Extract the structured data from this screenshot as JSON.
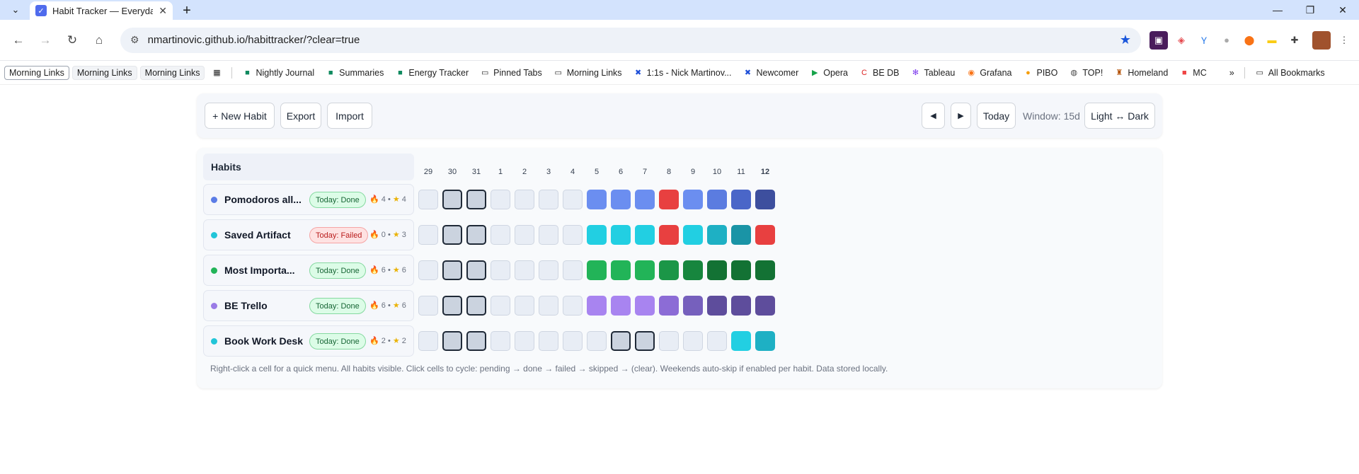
{
  "browser": {
    "tab_title": "Habit Tracker — Everyday-style",
    "url": "nmartinovic.github.io/habittracker/?clear=true",
    "bookmarks": [
      "Morning Links",
      "Morning Links",
      "Morning Links",
      "Nightly Journal",
      "Summaries",
      "Energy Tracker",
      "Pinned Tabs",
      "Morning Links",
      "1:1s - Nick Martinov...",
      "Newcomer",
      "Opera",
      "BE DB",
      "Tableau",
      "Grafana",
      "PIBO",
      "TOP!",
      "Homeland",
      "MC"
    ],
    "all_bookmarks": "All Bookmarks"
  },
  "toolbar": {
    "new_habit": "+ New Habit",
    "export": "Export",
    "import": "Import",
    "prev": "◀",
    "next": "▶",
    "today": "Today",
    "window": "Window: 15d",
    "theme": "Light ↔ Dark"
  },
  "grid": {
    "header": "Habits",
    "days": [
      "29",
      "30",
      "31",
      "1",
      "2",
      "3",
      "4",
      "5",
      "6",
      "7",
      "8",
      "9",
      "10",
      "11",
      "12"
    ],
    "today_index": 14
  },
  "habits": [
    {
      "name": "Pomodoros all...",
      "status": "Today: Done",
      "status_type": "done",
      "streak": "4",
      "best": "4",
      "color": "#5b7ce6",
      "cells": [
        "e",
        "s",
        "s",
        "e",
        "e",
        "e",
        "e",
        "#6b8ef0",
        "#6b8ef0",
        "#6b8ef0",
        "#e84040",
        "#6b8ef0",
        "#5b7ce0",
        "#4a66c8",
        "#3d4f9e"
      ],
      "marked": [
        6,
        7,
        8
      ]
    },
    {
      "name": "Saved Artifact",
      "status": "Today: Failed",
      "status_type": "failed",
      "streak": "0",
      "best": "3",
      "color": "#22c5d8",
      "cells": [
        "e",
        "s",
        "s",
        "e",
        "e",
        "e",
        "e",
        "#22cfe2",
        "#22cfe2",
        "#22cfe2",
        "#e84040",
        "#22cfe2",
        "#1eb0c4",
        "#1a94a6",
        "#e84040"
      ],
      "marked": [
        6,
        7,
        8
      ]
    },
    {
      "name": "Most Importa...",
      "status": "Today: Done",
      "status_type": "done",
      "streak": "6",
      "best": "6",
      "color": "#22b458",
      "cells": [
        "e",
        "s",
        "s",
        "e",
        "e",
        "e",
        "e",
        "#22b458",
        "#22b458",
        "#22b458",
        "#1b9647",
        "#17863e",
        "#137234",
        "#137234",
        "#137234"
      ],
      "marked": [
        6,
        7,
        8
      ]
    },
    {
      "name": "BE Trello",
      "status": "Today: Done",
      "status_type": "done",
      "streak": "6",
      "best": "6",
      "color": "#9a7be6",
      "cells": [
        "e",
        "s",
        "s",
        "e",
        "e",
        "e",
        "e",
        "#a884f0",
        "#a884f0",
        "#a884f0",
        "#8c6cd6",
        "#7660bd",
        "#5e4d9c",
        "#5e4d9c",
        "#5e4d9c"
      ],
      "marked": [
        6,
        7,
        8
      ]
    },
    {
      "name": "Book Work Desk",
      "status": "Today: Done",
      "status_type": "done",
      "streak": "2",
      "best": "2",
      "color": "#22c5d8",
      "cells": [
        "e",
        "s",
        "s",
        "e",
        "e",
        "e",
        "e",
        "e",
        "s",
        "s",
        "e",
        "e",
        "e",
        "#22cfe2",
        "#1eb0c4"
      ],
      "marked": []
    }
  ],
  "hint": "Right-click a cell for a quick menu. All habits visible. Click cells to cycle: pending → done → failed → skipped → (clear). Weekends auto-skip if enabled per habit. Data stored locally."
}
